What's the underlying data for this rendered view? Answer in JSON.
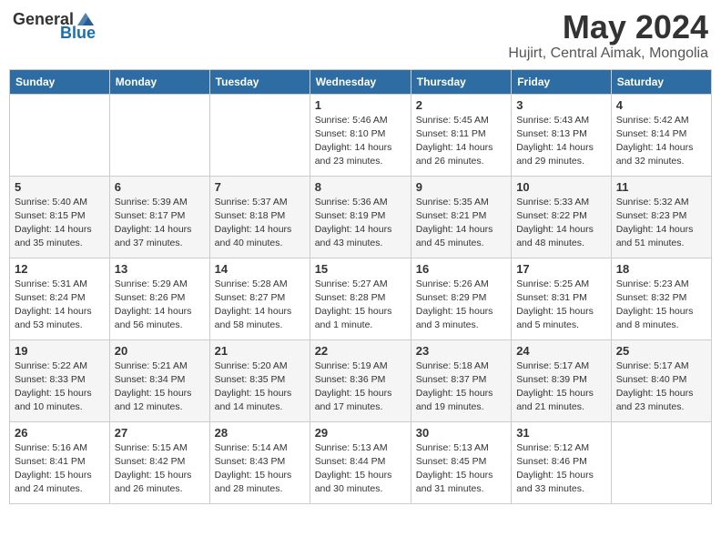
{
  "header": {
    "logo_general": "General",
    "logo_blue": "Blue",
    "title": "May 2024",
    "subtitle": "Hujirt, Central Aimak, Mongolia"
  },
  "weekdays": [
    "Sunday",
    "Monday",
    "Tuesday",
    "Wednesday",
    "Thursday",
    "Friday",
    "Saturday"
  ],
  "weeks": [
    [
      {
        "day": "",
        "info": ""
      },
      {
        "day": "",
        "info": ""
      },
      {
        "day": "",
        "info": ""
      },
      {
        "day": "1",
        "info": "Sunrise: 5:46 AM\nSunset: 8:10 PM\nDaylight: 14 hours\nand 23 minutes."
      },
      {
        "day": "2",
        "info": "Sunrise: 5:45 AM\nSunset: 8:11 PM\nDaylight: 14 hours\nand 26 minutes."
      },
      {
        "day": "3",
        "info": "Sunrise: 5:43 AM\nSunset: 8:13 PM\nDaylight: 14 hours\nand 29 minutes."
      },
      {
        "day": "4",
        "info": "Sunrise: 5:42 AM\nSunset: 8:14 PM\nDaylight: 14 hours\nand 32 minutes."
      }
    ],
    [
      {
        "day": "5",
        "info": "Sunrise: 5:40 AM\nSunset: 8:15 PM\nDaylight: 14 hours\nand 35 minutes."
      },
      {
        "day": "6",
        "info": "Sunrise: 5:39 AM\nSunset: 8:17 PM\nDaylight: 14 hours\nand 37 minutes."
      },
      {
        "day": "7",
        "info": "Sunrise: 5:37 AM\nSunset: 8:18 PM\nDaylight: 14 hours\nand 40 minutes."
      },
      {
        "day": "8",
        "info": "Sunrise: 5:36 AM\nSunset: 8:19 PM\nDaylight: 14 hours\nand 43 minutes."
      },
      {
        "day": "9",
        "info": "Sunrise: 5:35 AM\nSunset: 8:21 PM\nDaylight: 14 hours\nand 45 minutes."
      },
      {
        "day": "10",
        "info": "Sunrise: 5:33 AM\nSunset: 8:22 PM\nDaylight: 14 hours\nand 48 minutes."
      },
      {
        "day": "11",
        "info": "Sunrise: 5:32 AM\nSunset: 8:23 PM\nDaylight: 14 hours\nand 51 minutes."
      }
    ],
    [
      {
        "day": "12",
        "info": "Sunrise: 5:31 AM\nSunset: 8:24 PM\nDaylight: 14 hours\nand 53 minutes."
      },
      {
        "day": "13",
        "info": "Sunrise: 5:29 AM\nSunset: 8:26 PM\nDaylight: 14 hours\nand 56 minutes."
      },
      {
        "day": "14",
        "info": "Sunrise: 5:28 AM\nSunset: 8:27 PM\nDaylight: 14 hours\nand 58 minutes."
      },
      {
        "day": "15",
        "info": "Sunrise: 5:27 AM\nSunset: 8:28 PM\nDaylight: 15 hours\nand 1 minute."
      },
      {
        "day": "16",
        "info": "Sunrise: 5:26 AM\nSunset: 8:29 PM\nDaylight: 15 hours\nand 3 minutes."
      },
      {
        "day": "17",
        "info": "Sunrise: 5:25 AM\nSunset: 8:31 PM\nDaylight: 15 hours\nand 5 minutes."
      },
      {
        "day": "18",
        "info": "Sunrise: 5:23 AM\nSunset: 8:32 PM\nDaylight: 15 hours\nand 8 minutes."
      }
    ],
    [
      {
        "day": "19",
        "info": "Sunrise: 5:22 AM\nSunset: 8:33 PM\nDaylight: 15 hours\nand 10 minutes."
      },
      {
        "day": "20",
        "info": "Sunrise: 5:21 AM\nSunset: 8:34 PM\nDaylight: 15 hours\nand 12 minutes."
      },
      {
        "day": "21",
        "info": "Sunrise: 5:20 AM\nSunset: 8:35 PM\nDaylight: 15 hours\nand 14 minutes."
      },
      {
        "day": "22",
        "info": "Sunrise: 5:19 AM\nSunset: 8:36 PM\nDaylight: 15 hours\nand 17 minutes."
      },
      {
        "day": "23",
        "info": "Sunrise: 5:18 AM\nSunset: 8:37 PM\nDaylight: 15 hours\nand 19 minutes."
      },
      {
        "day": "24",
        "info": "Sunrise: 5:17 AM\nSunset: 8:39 PM\nDaylight: 15 hours\nand 21 minutes."
      },
      {
        "day": "25",
        "info": "Sunrise: 5:17 AM\nSunset: 8:40 PM\nDaylight: 15 hours\nand 23 minutes."
      }
    ],
    [
      {
        "day": "26",
        "info": "Sunrise: 5:16 AM\nSunset: 8:41 PM\nDaylight: 15 hours\nand 24 minutes."
      },
      {
        "day": "27",
        "info": "Sunrise: 5:15 AM\nSunset: 8:42 PM\nDaylight: 15 hours\nand 26 minutes."
      },
      {
        "day": "28",
        "info": "Sunrise: 5:14 AM\nSunset: 8:43 PM\nDaylight: 15 hours\nand 28 minutes."
      },
      {
        "day": "29",
        "info": "Sunrise: 5:13 AM\nSunset: 8:44 PM\nDaylight: 15 hours\nand 30 minutes."
      },
      {
        "day": "30",
        "info": "Sunrise: 5:13 AM\nSunset: 8:45 PM\nDaylight: 15 hours\nand 31 minutes."
      },
      {
        "day": "31",
        "info": "Sunrise: 5:12 AM\nSunset: 8:46 PM\nDaylight: 15 hours\nand 33 minutes."
      },
      {
        "day": "",
        "info": ""
      }
    ]
  ]
}
